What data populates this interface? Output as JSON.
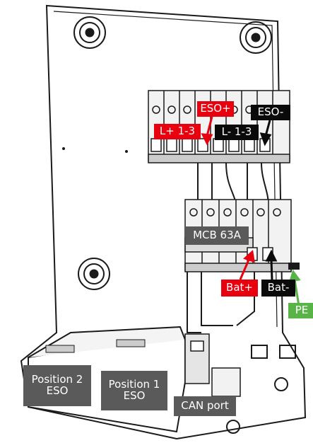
{
  "labels": {
    "l_plus": "L+ 1-3",
    "eso_plus": "ESO+",
    "l_minus": "L- 1-3",
    "eso_minus": "ESO-",
    "mcb": "MCB 63A",
    "bat_plus": "Bat+",
    "bat_minus": "Bat-",
    "pe": "PE",
    "pos2_line1": "Position 2",
    "pos2_line2": "ESO",
    "pos1_line1": "Position 1",
    "pos1_line2": "ESO",
    "can": "CAN port"
  },
  "colors": {
    "red": "#e8000e",
    "black": "#0a0a0a",
    "green": "#59b447",
    "gray": "#5a5a5a"
  }
}
